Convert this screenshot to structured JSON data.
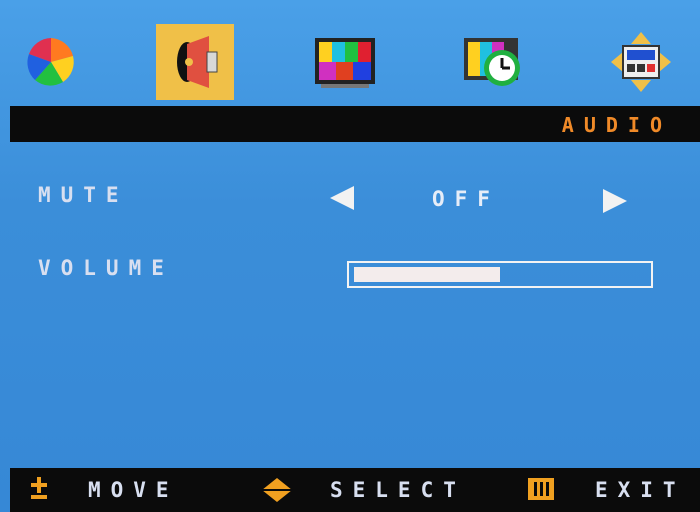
{
  "menu": {
    "tabs": [
      {
        "name": "color",
        "icon": "color-wheel-icon",
        "selected": false
      },
      {
        "name": "audio",
        "icon": "speaker-icon",
        "selected": true
      },
      {
        "name": "picture",
        "icon": "tv-color-bars-icon",
        "selected": false
      },
      {
        "name": "timer",
        "icon": "clock-icon",
        "selected": false
      },
      {
        "name": "setup",
        "icon": "setup-arrows-icon",
        "selected": false
      }
    ],
    "title": "AUDIO"
  },
  "settings": {
    "mute": {
      "label": "MUTE",
      "value": "OFF"
    },
    "volume": {
      "label": "VOLUME",
      "level": 0.5
    }
  },
  "footer": {
    "move": "MOVE",
    "select": "SELECT",
    "exit": "EXIT"
  },
  "colors": {
    "background": "#3a8fd8",
    "title_accent": "#f08a28",
    "selected_tab": "#f0c048",
    "hint_icon": "#f0a020"
  }
}
